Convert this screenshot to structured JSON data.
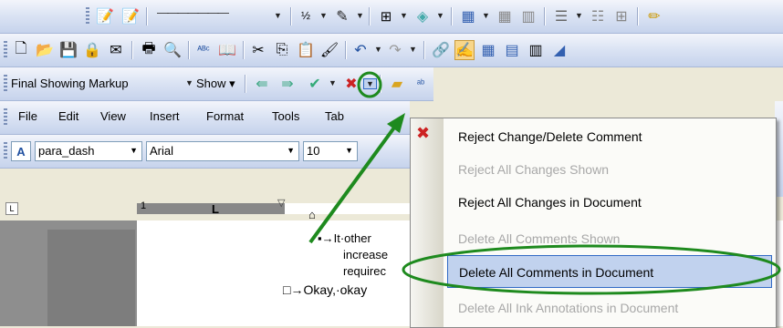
{
  "toolbar1": {
    "line_style": "———————",
    "line_weight": "½",
    "dropdown_arrow": "▾"
  },
  "review_toolbar": {
    "display_mode": "Final Showing Markup",
    "show_label": "Show",
    "show_accel": "S"
  },
  "menubar": {
    "items": [
      {
        "label": "File",
        "accel": "F"
      },
      {
        "label": "Edit",
        "accel": "E"
      },
      {
        "label": "View",
        "accel": "V"
      },
      {
        "label": "Insert",
        "accel": "I"
      },
      {
        "label": "Format",
        "accel": "o"
      },
      {
        "label": "Tools",
        "accel": "T"
      },
      {
        "label": "Tab",
        "accel": "a"
      }
    ]
  },
  "format_toolbar": {
    "style": "para_dash",
    "font": "Arial",
    "size": "10"
  },
  "ruler": {
    "marker": "1"
  },
  "document": {
    "line1": "▪→It·other",
    "line2": "increase",
    "line3": "requirec",
    "line4": "□→Okay,·okay"
  },
  "reject_menu": {
    "items": [
      {
        "label": "Reject Change/Delete Comment",
        "state": "enabled"
      },
      {
        "label": "Reject All Changes Shown",
        "state": "disabled"
      },
      {
        "label": "Reject All Changes in Document",
        "state": "enabled"
      },
      {
        "label": "Delete All Comments Shown",
        "state": "disabled"
      },
      {
        "label": "Delete All Comments in Document",
        "state": "highlighted"
      },
      {
        "label": "Delete All Ink Annotations in Document",
        "state": "disabled"
      }
    ]
  },
  "colors": {
    "highlight": "#C1D2EE",
    "annotation_green": "#1E8A1E",
    "disabled_text": "#A8A8A8"
  }
}
